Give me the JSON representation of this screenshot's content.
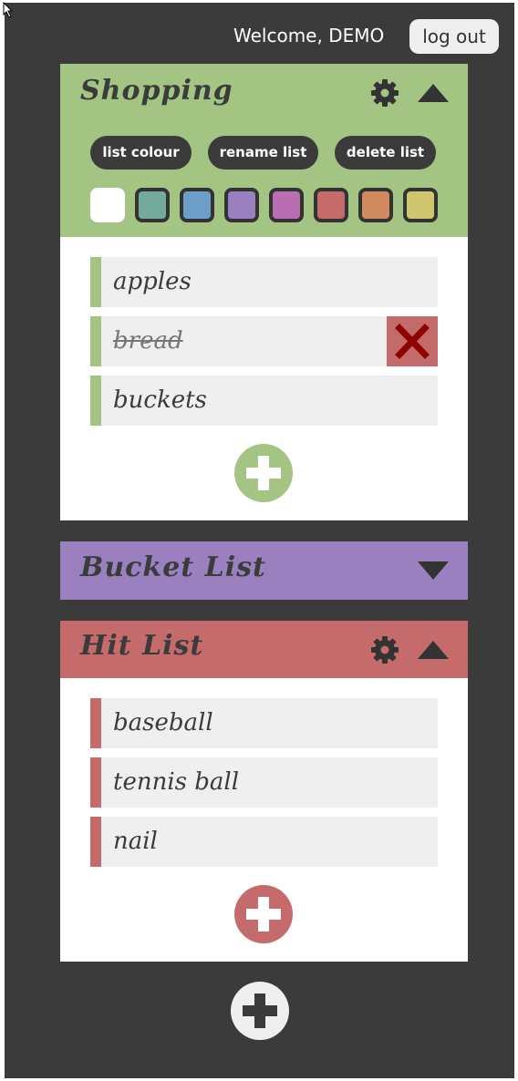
{
  "header": {
    "welcome": "Welcome, DEMO",
    "logout_label": "log out"
  },
  "lists": [
    {
      "title": "Shopping",
      "color": "#a4c484",
      "expanded": true,
      "settings_open": true,
      "buttons": {
        "colour": "list colour",
        "rename": "rename list",
        "delete": "delete list"
      },
      "items": [
        {
          "text": "apples",
          "done": false
        },
        {
          "text": "bread",
          "done": true
        },
        {
          "text": "buckets",
          "done": false
        }
      ]
    },
    {
      "title": "Bucket List",
      "color": "#9b80c0",
      "expanded": false
    },
    {
      "title": "Hit List",
      "color": "#c56b6b",
      "expanded": true,
      "items": [
        {
          "text": "baseball",
          "done": false
        },
        {
          "text": "tennis ball",
          "done": false
        },
        {
          "text": "nail",
          "done": false
        }
      ]
    }
  ],
  "swatches": [
    "#ffffff",
    "#75a99c",
    "#6e9ec7",
    "#9b80c0",
    "#b86eb0",
    "#c56b6b",
    "#d08a5e",
    "#cfc56e"
  ],
  "selected_swatch": 0,
  "icons": {
    "settings": "gear-icon",
    "collapse": "triangle-up-icon",
    "expand": "triangle-down-icon",
    "delete_item": "x-icon",
    "add_item": "plus-icon",
    "add_list": "plus-icon"
  }
}
